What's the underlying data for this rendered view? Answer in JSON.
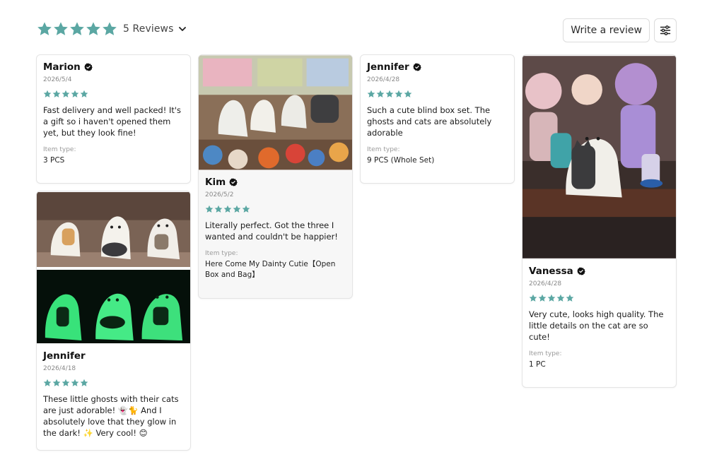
{
  "summary": {
    "reviews_label": "5 Reviews",
    "star_count": 5,
    "star_color": "#5ba7a3"
  },
  "actions": {
    "write_review_label": "Write a review"
  },
  "item_type_label": "Item type:",
  "reviews": [
    {
      "name": "Marion",
      "date": "2026/5/4",
      "rating": 5,
      "text": "Fast delivery and well packed! It's a gift so i haven't opened them yet, but they look fine!",
      "item_type": "3 PCS"
    },
    {
      "name": "Jennifer",
      "date": "2026/4/18",
      "rating": 5,
      "text": "These little ghosts with their cats are just adorable! 👻🐈 And I absolutely love that they glow in the dark! ✨ Very cool! 😊",
      "item_type": ""
    },
    {
      "name": "Kim",
      "date": "2026/5/2",
      "rating": 5,
      "text": "Literally perfect. Got the three I wanted and couldn't be happier!",
      "item_type": "Here Come My Dainty Cutie【Open Box and Bag】"
    },
    {
      "name": "Jennifer",
      "date": "2026/4/28",
      "rating": 5,
      "text": "Such a cute blind box set. The ghosts and cats are absolutely adorable",
      "item_type": "9 PCS (Whole Set)"
    },
    {
      "name": "Vanessa",
      "date": "2026/4/28",
      "rating": 5,
      "text": "Very cute, looks high quality. The little details on the cat are so cute!",
      "item_type": "1 PC"
    }
  ]
}
